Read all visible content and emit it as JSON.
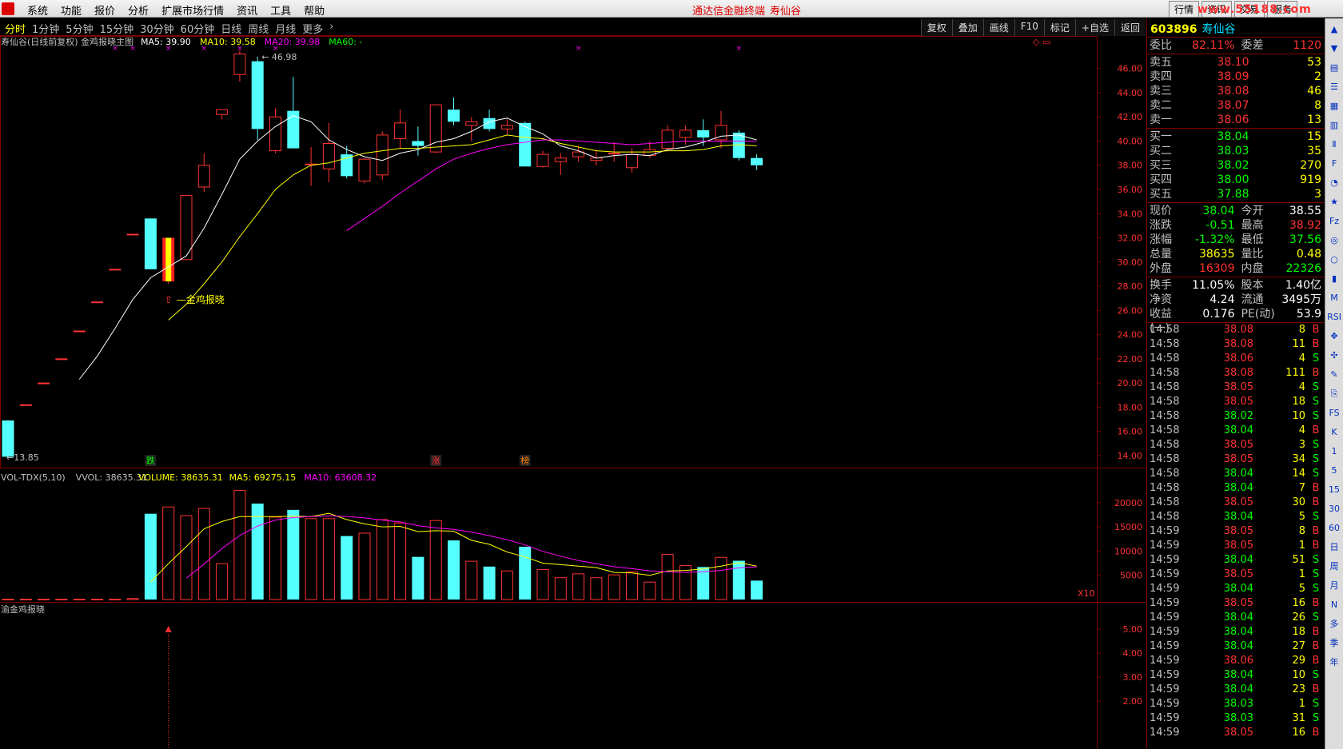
{
  "menubar": {
    "items": [
      "系统",
      "功能",
      "报价",
      "分析",
      "扩展市场行情",
      "资讯",
      "工具",
      "帮助"
    ],
    "promo": "通达信金融终端",
    "stock_name": "寿仙谷",
    "right_buttons": [
      "行情",
      "资讯",
      "交易",
      "服务"
    ],
    "watermark": "www.55188.com"
  },
  "toolbar": {
    "periods": [
      "分时",
      "1分钟",
      "5分钟",
      "15分钟",
      "30分钟",
      "60分钟",
      "日线",
      "周线",
      "月线",
      "更多"
    ],
    "active": "分时",
    "tools": [
      "复权",
      "叠加",
      "画线",
      "F10",
      "标记",
      "+自选",
      "返回"
    ]
  },
  "chart": {
    "main_title": "寿仙谷(日线前复权) 金鸡报晓主图",
    "ma5_label": "MA5: 39.90",
    "ma10_label": "MA10: 39.58",
    "ma20_label": "MA20: 39.98",
    "ma60_label": "MA60: -",
    "high_marker": "46.98",
    "low_marker": "13.85",
    "signal_label": "金鸡报晓",
    "event_labels": [
      "跌",
      "涨",
      "榜"
    ],
    "price_axis": [
      "46.00",
      "44.00",
      "42.00",
      "40.00",
      "38.00",
      "36.00",
      "34.00",
      "32.00",
      "30.00",
      "28.00",
      "26.00",
      "24.00",
      "22.00",
      "20.00",
      "18.00",
      "16.00",
      "14.00"
    ],
    "vol_title": "VOL-TDX(5,10)",
    "vol_vvol": "VVOL: 38635.31",
    "vol_volume": "VOLUME: 38635.31",
    "vol_ma5": "MA5: 69275.15",
    "vol_ma10": "MA10: 63608.32",
    "vol_axis": [
      "20000",
      "15000",
      "10000",
      "5000"
    ],
    "vol_unit": "X10",
    "ind_title": "渝金鸡报晓",
    "ind_axis": [
      "5.00",
      "4.00",
      "3.00",
      "2.00"
    ],
    "colors": {
      "up": "#ff3232",
      "down": "#54ffff",
      "ma5": "#ffffff",
      "ma10": "#ffff00",
      "ma20": "#ff00ff",
      "grid": "#800000"
    },
    "candles": [
      {
        "o": 16.9,
        "c": 13.9,
        "h": 16.9,
        "l": 13.85,
        "v": 0
      },
      {
        "o": 18.2,
        "c": 18.2,
        "h": 18.2,
        "l": 18.2,
        "v": 0
      },
      {
        "o": 20.0,
        "c": 20.0,
        "h": 20.0,
        "l": 20.0,
        "v": 0
      },
      {
        "o": 22.0,
        "c": 22.0,
        "h": 22.0,
        "l": 22.0,
        "v": 0
      },
      {
        "o": 24.3,
        "c": 24.3,
        "h": 24.3,
        "l": 24.3,
        "v": 0
      },
      {
        "o": 26.7,
        "c": 26.7,
        "h": 26.7,
        "l": 26.7,
        "v": 0
      },
      {
        "o": 29.4,
        "c": 29.4,
        "h": 29.4,
        "l": 29.4,
        "v": 0
      },
      {
        "o": 32.3,
        "c": 32.3,
        "h": 32.3,
        "l": 32.3,
        "v": 200
      },
      {
        "o": 33.6,
        "c": 29.4,
        "h": 33.6,
        "l": 29.4,
        "v": 17700
      },
      {
        "o": 28.4,
        "c": 32.0,
        "h": 32.0,
        "l": 28.2,
        "v": 19100,
        "sig": true
      },
      {
        "o": 30.2,
        "c": 35.5,
        "h": 35.5,
        "l": 30.2,
        "v": 17300
      },
      {
        "o": 36.2,
        "c": 38.0,
        "h": 39.0,
        "l": 35.8,
        "v": 18800
      },
      {
        "o": 42.2,
        "c": 42.6,
        "h": 42.6,
        "l": 41.8,
        "v": 7400
      },
      {
        "o": 45.5,
        "c": 47.2,
        "h": 47.5,
        "l": 44.9,
        "v": 22500
      },
      {
        "o": 46.6,
        "c": 41.0,
        "h": 46.98,
        "l": 40.1,
        "v": 19800
      },
      {
        "o": 39.2,
        "c": 42.0,
        "h": 42.7,
        "l": 39.0,
        "v": 17000
      },
      {
        "o": 42.5,
        "c": 39.4,
        "h": 45.3,
        "l": 39.4,
        "v": 18500
      },
      {
        "o": 38.1,
        "c": 38.1,
        "h": 39.5,
        "l": 36.3,
        "v": 16700
      },
      {
        "o": 37.7,
        "c": 39.8,
        "h": 41.5,
        "l": 36.6,
        "v": 16700
      },
      {
        "o": 38.9,
        "c": 37.1,
        "h": 39.6,
        "l": 36.9,
        "v": 13100
      },
      {
        "o": 36.7,
        "c": 38.5,
        "h": 38.6,
        "l": 36.5,
        "v": 13700
      },
      {
        "o": 37.2,
        "c": 40.5,
        "h": 40.8,
        "l": 36.8,
        "v": 16500
      },
      {
        "o": 40.2,
        "c": 41.5,
        "h": 42.6,
        "l": 39.4,
        "v": 15800
      },
      {
        "o": 40.0,
        "c": 39.6,
        "h": 41.2,
        "l": 38.8,
        "v": 8800
      },
      {
        "o": 39.1,
        "c": 43.0,
        "h": 43.0,
        "l": 39.0,
        "v": 16300
      },
      {
        "o": 42.6,
        "c": 41.6,
        "h": 43.6,
        "l": 41.3,
        "v": 12200
      },
      {
        "o": 41.3,
        "c": 41.6,
        "h": 42.0,
        "l": 40.0,
        "v": 7900
      },
      {
        "o": 41.9,
        "c": 41.0,
        "h": 42.6,
        "l": 40.8,
        "v": 6800
      },
      {
        "o": 41.0,
        "c": 41.3,
        "h": 41.8,
        "l": 40.5,
        "v": 5900
      },
      {
        "o": 41.5,
        "c": 37.9,
        "h": 41.6,
        "l": 37.9,
        "v": 10900
      },
      {
        "o": 37.9,
        "c": 38.9,
        "h": 39.2,
        "l": 37.8,
        "v": 6200
      },
      {
        "o": 38.3,
        "c": 38.6,
        "h": 39.0,
        "l": 37.2,
        "v": 4500
      },
      {
        "o": 38.7,
        "c": 39.1,
        "h": 39.6,
        "l": 38.3,
        "v": 5300
      },
      {
        "o": 38.4,
        "c": 38.6,
        "h": 39.3,
        "l": 38.0,
        "v": 4500
      },
      {
        "o": 39.0,
        "c": 39.0,
        "h": 39.9,
        "l": 38.3,
        "v": 5100
      },
      {
        "o": 37.8,
        "c": 38.9,
        "h": 39.4,
        "l": 37.4,
        "v": 5700
      },
      {
        "o": 38.8,
        "c": 39.3,
        "h": 40.0,
        "l": 38.6,
        "v": 3600
      },
      {
        "o": 39.4,
        "c": 40.9,
        "h": 41.3,
        "l": 39.3,
        "v": 9300
      },
      {
        "o": 40.3,
        "c": 40.9,
        "h": 41.3,
        "l": 39.7,
        "v": 7000
      },
      {
        "o": 40.9,
        "c": 40.3,
        "h": 41.8,
        "l": 39.6,
        "v": 6700
      },
      {
        "o": 40.1,
        "c": 41.3,
        "h": 42.5,
        "l": 39.4,
        "v": 8700
      },
      {
        "o": 40.7,
        "c": 38.6,
        "h": 40.9,
        "l": 38.4,
        "v": 8000
      },
      {
        "o": 38.6,
        "c": 38.0,
        "h": 38.9,
        "l": 37.6,
        "v": 3900
      }
    ],
    "ma5": [
      null,
      null,
      null,
      null,
      20.3,
      22.2,
      24.5,
      26.9,
      28.7,
      29.6,
      30.5,
      32.8,
      35.6,
      38.5,
      40.0,
      41.2,
      42.1,
      41.6,
      40.1,
      39.3,
      38.7,
      38.4,
      39.0,
      39.3,
      39.9,
      40.2,
      40.8,
      41.6,
      41.9,
      41.2,
      40.6,
      39.6,
      39.2,
      38.6,
      38.8,
      38.9,
      38.8,
      39.3,
      39.5,
      39.9,
      40.4,
      40.5,
      40.1
    ],
    "ma10": [
      null,
      null,
      null,
      null,
      null,
      null,
      null,
      null,
      null,
      25.2,
      26.5,
      28.2,
      30.0,
      32.1,
      34.0,
      36.0,
      37.2,
      38.0,
      38.2,
      38.6,
      39.0,
      39.2,
      39.4,
      39.4,
      39.5,
      39.6,
      39.7,
      40.1,
      40.5,
      40.3,
      40.2,
      39.8,
      39.5,
      39.2,
      39.1,
      39.1,
      39.1,
      39.2,
      39.2,
      39.3,
      39.6,
      39.7,
      39.6
    ],
    "ma20": [
      null,
      null,
      null,
      null,
      null,
      null,
      null,
      null,
      null,
      null,
      null,
      null,
      null,
      null,
      null,
      null,
      null,
      null,
      null,
      32.6,
      33.6,
      34.6,
      35.7,
      36.7,
      37.7,
      38.5,
      39.0,
      39.4,
      39.7,
      39.9,
      40.1,
      40.1,
      40.0,
      39.9,
      39.8,
      39.7,
      39.8,
      39.9,
      40.0,
      40.0,
      40.0,
      40.0,
      39.98
    ],
    "vma5": [
      0,
      0,
      0,
      0,
      0,
      0,
      0,
      0,
      3600,
      7400,
      10900,
      14600,
      16100,
      17100,
      17100,
      17100,
      17200,
      17100,
      17800,
      16500,
      15600,
      15000,
      15100,
      14000,
      14200,
      14100,
      12200,
      11400,
      9800,
      8800,
      7500,
      7200,
      6900,
      6600,
      5600,
      5500,
      5000,
      5900,
      6000,
      6300,
      6900,
      7600,
      6900
    ],
    "vma10": [
      0,
      0,
      0,
      0,
      0,
      0,
      0,
      0,
      0,
      0,
      0,
      0,
      0,
      0,
      0,
      0,
      0,
      0,
      0,
      0,
      0,
      0,
      0,
      0,
      0,
      0,
      0,
      0,
      0,
      0,
      0,
      0,
      0,
      0,
      0,
      0,
      0,
      0,
      0,
      0,
      0,
      0,
      0
    ]
  },
  "quote": {
    "code": "603896",
    "name": "寿仙谷",
    "wei_bi_label": "委比",
    "wei_bi": "82.11%",
    "wei_cha_label": "委差",
    "wei_cha": "1120",
    "asks": [
      {
        "label": "卖五",
        "price": "38.10",
        "vol": "53"
      },
      {
        "label": "卖四",
        "price": "38.09",
        "vol": "2"
      },
      {
        "label": "卖三",
        "price": "38.08",
        "vol": "46"
      },
      {
        "label": "卖二",
        "price": "38.07",
        "vol": "8"
      },
      {
        "label": "卖一",
        "price": "38.06",
        "vol": "13"
      }
    ],
    "bids": [
      {
        "label": "买一",
        "price": "38.04",
        "vol": "15"
      },
      {
        "label": "买二",
        "price": "38.03",
        "vol": "35"
      },
      {
        "label": "买三",
        "price": "38.02",
        "vol": "270"
      },
      {
        "label": "买四",
        "price": "38.00",
        "vol": "919"
      },
      {
        "label": "买五",
        "price": "37.88",
        "vol": "3"
      }
    ],
    "stats": [
      {
        "l": "现价",
        "v": "38.04",
        "vc": "green",
        "l2": "今开",
        "v2": "38.55",
        "v2c": "white"
      },
      {
        "l": "涨跌",
        "v": "-0.51",
        "vc": "green",
        "l2": "最高",
        "v2": "38.92",
        "v2c": "red"
      },
      {
        "l": "涨幅",
        "v": "-1.32%",
        "vc": "green",
        "l2": "最低",
        "v2": "37.56",
        "v2c": "green"
      },
      {
        "l": "总量",
        "v": "38635",
        "vc": "yellow",
        "l2": "量比",
        "v2": "0.48",
        "v2c": "yellow"
      },
      {
        "l": "外盘",
        "v": "16309",
        "vc": "red",
        "l2": "内盘",
        "v2": "22326",
        "v2c": "green"
      }
    ],
    "stats2": [
      {
        "l": "换手",
        "v": "11.05%",
        "vc": "white",
        "l2": "股本",
        "v2": "1.40亿",
        "v2c": "white"
      },
      {
        "l": "净资",
        "v": "4.24",
        "vc": "white",
        "l2": "流通",
        "v2": "3495万",
        "v2c": "white"
      },
      {
        "l": "收益(一)",
        "v": "0.176",
        "vc": "white",
        "l2": "PE(动)",
        "v2": "53.9",
        "v2c": "white"
      }
    ],
    "ticks": [
      {
        "t": "14:58",
        "p": "38.08",
        "v": "8",
        "bs": "B"
      },
      {
        "t": "14:58",
        "p": "38.08",
        "v": "11",
        "bs": "B"
      },
      {
        "t": "14:58",
        "p": "38.06",
        "v": "4",
        "bs": "S"
      },
      {
        "t": "14:58",
        "p": "38.08",
        "v": "111",
        "bs": "B"
      },
      {
        "t": "14:58",
        "p": "38.05",
        "v": "4",
        "bs": "S"
      },
      {
        "t": "14:58",
        "p": "38.05",
        "v": "18",
        "bs": "S"
      },
      {
        "t": "14:58",
        "p": "38.02",
        "v": "10",
        "bs": "S"
      },
      {
        "t": "14:58",
        "p": "38.04",
        "v": "4",
        "bs": "B"
      },
      {
        "t": "14:58",
        "p": "38.05",
        "v": "3",
        "bs": "S"
      },
      {
        "t": "14:58",
        "p": "38.05",
        "v": "34",
        "bs": "S"
      },
      {
        "t": "14:58",
        "p": "38.04",
        "v": "14",
        "bs": "S"
      },
      {
        "t": "14:58",
        "p": "38.04",
        "v": "7",
        "bs": "B"
      },
      {
        "t": "14:58",
        "p": "38.05",
        "v": "30",
        "bs": "B"
      },
      {
        "t": "14:58",
        "p": "38.04",
        "v": "5",
        "bs": "S"
      },
      {
        "t": "14:59",
        "p": "38.05",
        "v": "8",
        "bs": "B"
      },
      {
        "t": "14:59",
        "p": "38.05",
        "v": "1",
        "bs": "B"
      },
      {
        "t": "14:59",
        "p": "38.04",
        "v": "51",
        "bs": "S"
      },
      {
        "t": "14:59",
        "p": "38.05",
        "v": "1",
        "bs": "S"
      },
      {
        "t": "14:59",
        "p": "38.04",
        "v": "5",
        "bs": "S"
      },
      {
        "t": "14:59",
        "p": "38.05",
        "v": "16",
        "bs": "B"
      },
      {
        "t": "14:59",
        "p": "38.04",
        "v": "26",
        "bs": "S"
      },
      {
        "t": "14:59",
        "p": "38.04",
        "v": "18",
        "bs": "B"
      },
      {
        "t": "14:59",
        "p": "38.04",
        "v": "27",
        "bs": "B"
      },
      {
        "t": "14:59",
        "p": "38.06",
        "v": "29",
        "bs": "B"
      },
      {
        "t": "14:59",
        "p": "38.04",
        "v": "10",
        "bs": "S"
      },
      {
        "t": "14:59",
        "p": "38.04",
        "v": "23",
        "bs": "B"
      },
      {
        "t": "14:59",
        "p": "38.03",
        "v": "1",
        "bs": "S"
      },
      {
        "t": "14:59",
        "p": "38.03",
        "v": "31",
        "bs": "S"
      },
      {
        "t": "14:59",
        "p": "38.05",
        "v": "16",
        "bs": "B"
      }
    ]
  },
  "sidebar": {
    "icons": [
      "up-arrow-icon",
      "down-arrow-icon",
      "chart-icon",
      "list-icon",
      "grid-icon",
      "kline-icon",
      "ii-icon",
      "f10-icon",
      "pie-icon",
      "star-icon",
      "fz-icon",
      "zoom-icon",
      "circle-icon",
      "bar-icon",
      "macd-icon",
      "rsi-icon",
      "cross-icon",
      "move-icon",
      "pen-icon",
      "link-icon",
      "fs-icon",
      "k-icon"
    ],
    "labels": [
      "1",
      "5",
      "15",
      "30",
      "60",
      "日",
      "周",
      "月",
      "N",
      "多",
      "季",
      "年"
    ]
  }
}
